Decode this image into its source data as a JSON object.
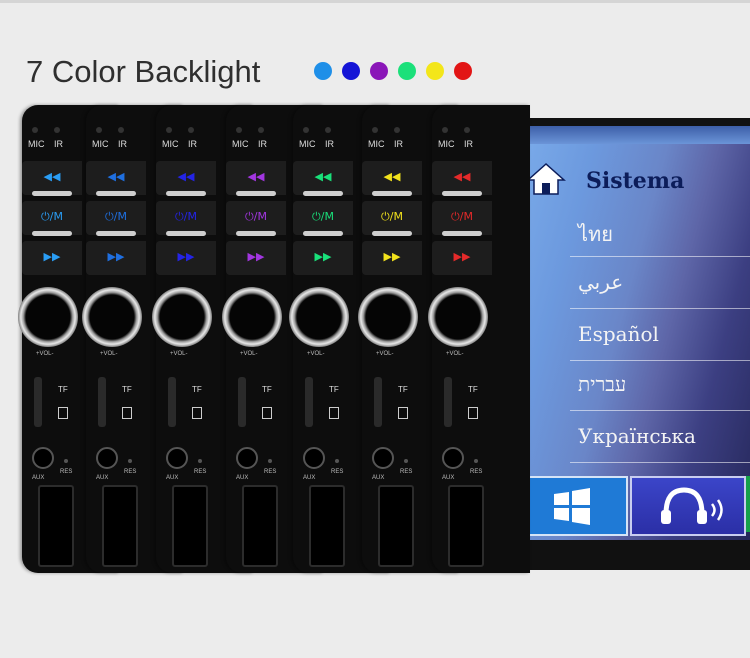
{
  "heading": "7 Color Backlight",
  "backlight_colors": [
    "#1f8fe8",
    "#1414d6",
    "#8a16b8",
    "#1be07a",
    "#f3e61a",
    "#e21515"
  ],
  "panel": {
    "mic_label": "MIC",
    "ir_label": "IR",
    "mode_label": "/M",
    "vol_label": "+VOL-",
    "tf_label": "TF",
    "aux_label": "AUX",
    "res_label": "RES"
  },
  "panel_colors": [
    "#2a9df4",
    "#1f6fe0",
    "#2424e6",
    "#a236e0",
    "#19e07a",
    "#f2e21c",
    "#e52a2a"
  ],
  "screen": {
    "title": "Sistema",
    "languages": [
      "ไทย",
      "عربي",
      "Español",
      "עברית",
      "Українська"
    ],
    "home_icon": "home-icon",
    "tile_icons": [
      "windows-icon",
      "headphones-icon"
    ]
  }
}
